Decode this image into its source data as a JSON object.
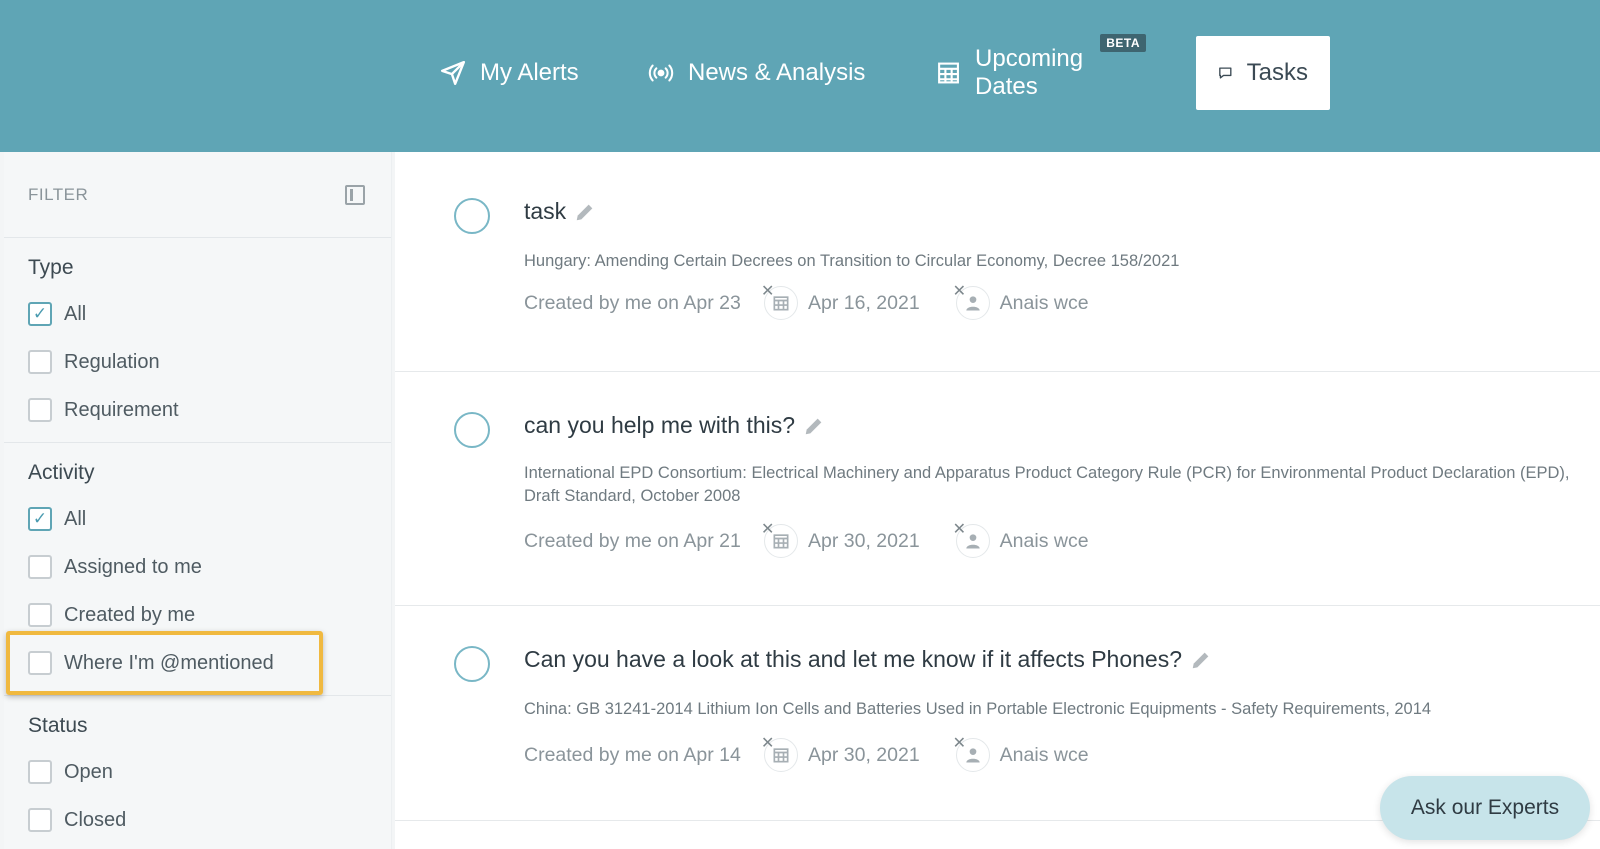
{
  "nav": {
    "items": [
      {
        "label": "My Alerts",
        "icon": "paper-plane-icon"
      },
      {
        "label": "News & Analysis",
        "icon": "broadcast-icon"
      },
      {
        "label": "Upcoming Dates",
        "icon": "calendar-grid-icon",
        "badge": "BETA"
      },
      {
        "label": "Tasks",
        "icon": "chat-icon",
        "active": true
      }
    ]
  },
  "sidebar": {
    "filter_title": "FILTER",
    "sections": [
      {
        "title": "Type",
        "options": [
          {
            "label": "All",
            "checked": true
          },
          {
            "label": "Regulation",
            "checked": false
          },
          {
            "label": "Requirement",
            "checked": false
          }
        ]
      },
      {
        "title": "Activity",
        "options": [
          {
            "label": "All",
            "checked": true
          },
          {
            "label": "Assigned to me",
            "checked": false
          },
          {
            "label": "Created by me",
            "checked": false
          },
          {
            "label": "Where I'm @mentioned",
            "checked": false,
            "highlighted": true
          }
        ]
      },
      {
        "title": "Status",
        "options": [
          {
            "label": "Open",
            "checked": false
          },
          {
            "label": "Closed",
            "checked": false
          }
        ]
      }
    ]
  },
  "tasks": [
    {
      "title": "task",
      "description": "Hungary: Amending Certain Decrees on Transition to Circular Economy, Decree 158/2021",
      "created": "Created by me on Apr 23",
      "due_date": "Apr 16, 2021",
      "assignee": "Anais wce"
    },
    {
      "title": "can you help me with this?",
      "description": "International EPD Consortium: Electrical Machinery and Apparatus Product Category Rule (PCR) for Environmental Product Declaration (EPD), Draft Standard, October 2008",
      "created": "Created by me on Apr 21",
      "due_date": "Apr 30, 2021",
      "assignee": "Anais wce"
    },
    {
      "title": "Can you have a look at this and let me know if it affects Phones?",
      "description": "China: GB 31241-2014 Lithium Ion Cells and Batteries Used in Portable Electronic Equipments - Safety Requirements, 2014",
      "created": "Created by me on Apr 14",
      "due_date": "Apr 30, 2021",
      "assignee": "Anais wce"
    }
  ],
  "ask_button": "Ask our Experts",
  "colors": {
    "header": "#5fa5b5",
    "highlight": "#f0b940",
    "check": "#4b9bb0"
  }
}
